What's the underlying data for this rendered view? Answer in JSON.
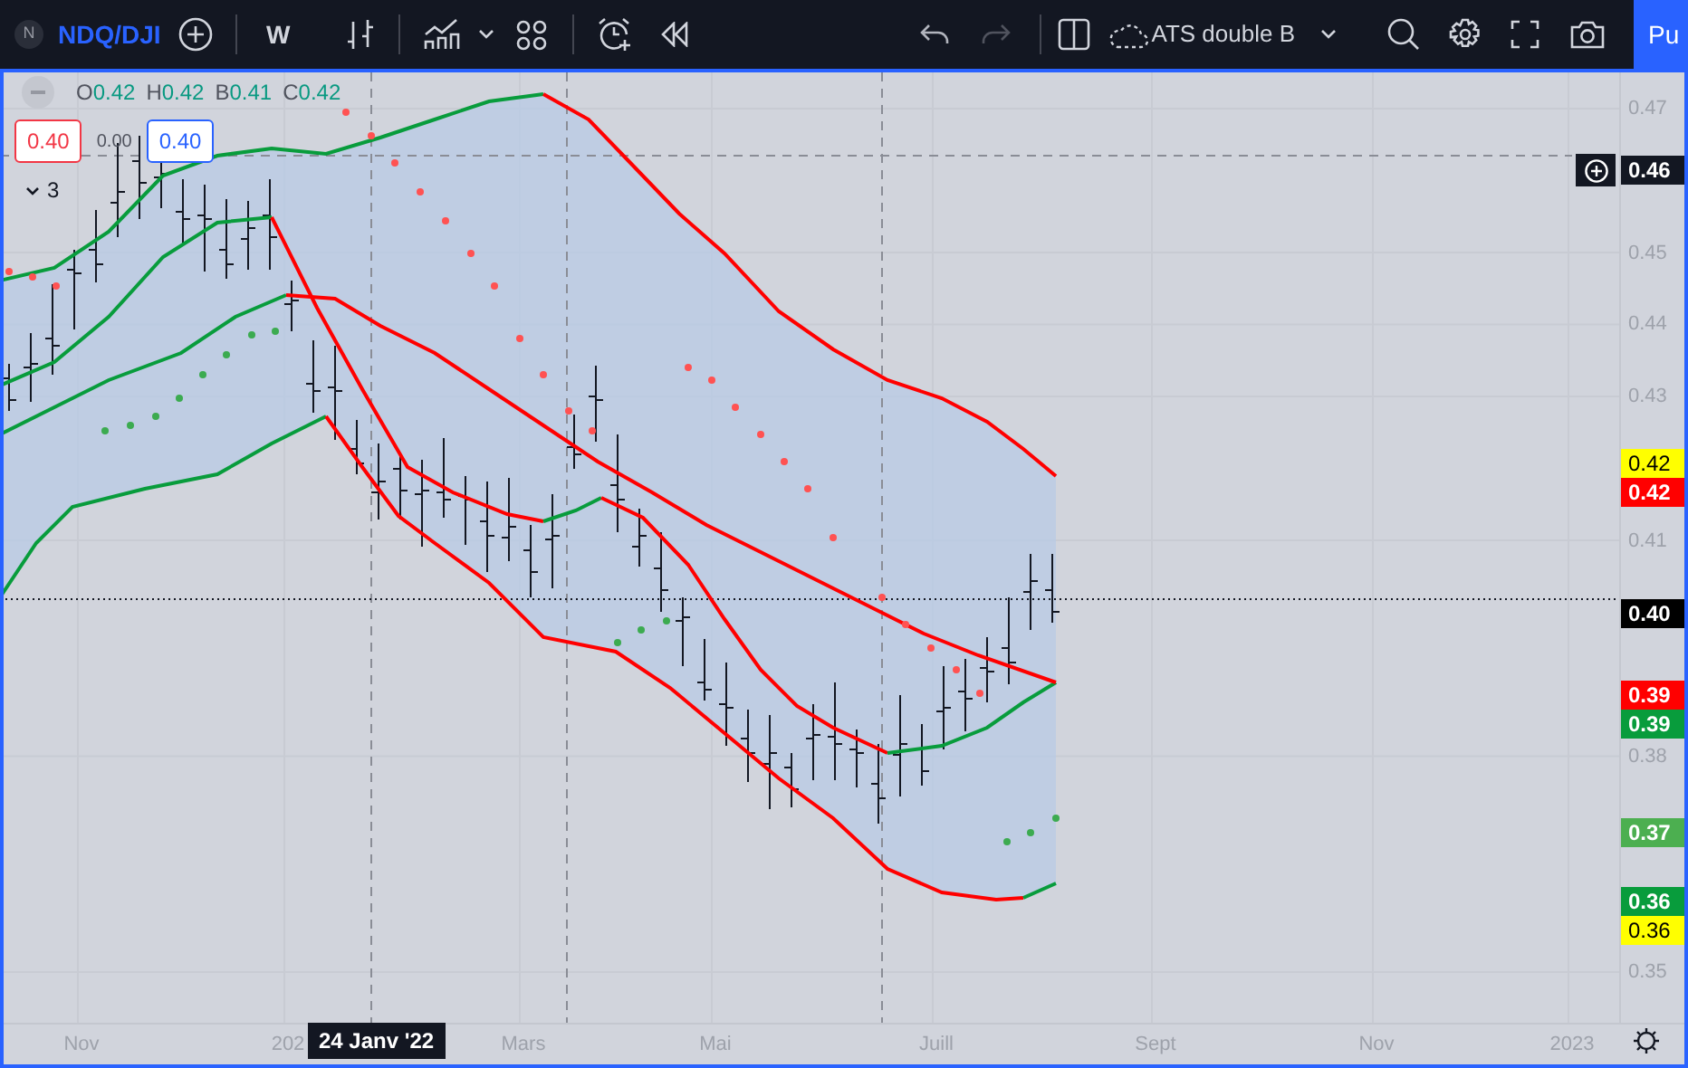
{
  "toolbar": {
    "symbol_initial": "N",
    "symbol": "NDQ/DJI",
    "interval": "W",
    "layout_name": "ATS double B",
    "publish_button": "Pu"
  },
  "legend": {
    "ohlc": [
      {
        "key": "O",
        "value": "0.42"
      },
      {
        "key": "H",
        "value": "0.42"
      },
      {
        "key": "B",
        "value": "0.41"
      },
      {
        "key": "C",
        "value": "0.42"
      }
    ],
    "price_boxes": [
      {
        "text": "0.40",
        "kind": "sell"
      },
      {
        "text": "0.00",
        "kind": "spread"
      },
      {
        "text": "0.40",
        "kind": "buy"
      }
    ],
    "indicators_count": "3"
  },
  "price_axis": {
    "ticks": [
      "0.47",
      "0.45",
      "0.44",
      "0.43",
      "0.41",
      "0.38",
      "0.35"
    ],
    "labels": [
      {
        "text": "0.46",
        "kind": "crosshair",
        "color": "#131722"
      },
      {
        "text": "0.42",
        "kind": "value",
        "color": "#ffff00"
      },
      {
        "text": "0.42",
        "kind": "value",
        "color": "#ff0000"
      },
      {
        "text": "0.40",
        "kind": "last",
        "color": "#000000"
      },
      {
        "text": "0.39",
        "kind": "value",
        "color": "#ff0000"
      },
      {
        "text": "0.39",
        "kind": "value",
        "color": "#089c3c"
      },
      {
        "text": "0.37",
        "kind": "value",
        "color": "#4caf50"
      },
      {
        "text": "0.36",
        "kind": "value",
        "color": "#089c3c"
      },
      {
        "text": "0.36",
        "kind": "value",
        "color": "#ffff00"
      }
    ]
  },
  "time_axis": {
    "ticks": [
      "Nov",
      "202",
      "Mars",
      "Mai",
      "Juill",
      "Sept",
      "Nov",
      "2023"
    ],
    "crosshair_label": "24 Janv '22"
  }
}
